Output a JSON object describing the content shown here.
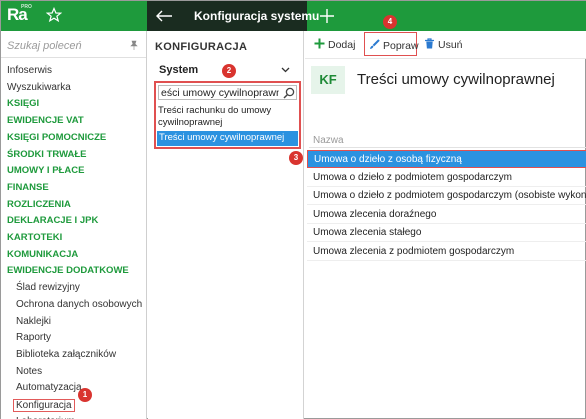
{
  "app": {
    "logo_text": "Ra",
    "logo_badge": "PRO",
    "window_title": "Konfiguracja systemu"
  },
  "leftnav": {
    "search_placeholder": "Szukaj poleceń",
    "items": [
      {
        "label": "Infoserwis",
        "kind": "plain"
      },
      {
        "label": "Wyszukiwarka",
        "kind": "plain"
      },
      {
        "label": "KSIĘGI",
        "kind": "sect"
      },
      {
        "label": "EWIDENCJE VAT",
        "kind": "sect"
      },
      {
        "label": "KSIĘGI POMOCNICZE",
        "kind": "sect"
      },
      {
        "label": "ŚRODKI TRWAŁE",
        "kind": "sect"
      },
      {
        "label": "UMOWY I PŁACE",
        "kind": "sect"
      },
      {
        "label": "FINANSE",
        "kind": "sect"
      },
      {
        "label": "ROZLICZENIA",
        "kind": "sect"
      },
      {
        "label": "DEKLARACJE I JPK",
        "kind": "sect"
      },
      {
        "label": "KARTOTEKI",
        "kind": "sect"
      },
      {
        "label": "KOMUNIKACJA",
        "kind": "sect"
      },
      {
        "label": "EWIDENCJE DODATKOWE",
        "kind": "sect"
      },
      {
        "label": "Ślad rewizyjny",
        "kind": "sub"
      },
      {
        "label": "Ochrona danych osobowych",
        "kind": "sub"
      },
      {
        "label": "Naklejki",
        "kind": "sub"
      },
      {
        "label": "Raporty",
        "kind": "sub"
      },
      {
        "label": "Biblioteka załączników",
        "kind": "sub"
      },
      {
        "label": "Notes",
        "kind": "sub"
      },
      {
        "label": "Automatyzacja",
        "kind": "sub"
      },
      {
        "label": "Konfiguracja",
        "kind": "sub"
      },
      {
        "label": "Laboratorium",
        "kind": "sub"
      }
    ]
  },
  "config": {
    "title": "KONFIGURACJA",
    "combo_value": "System",
    "search_value": "eści umowy cywilnoprawnej",
    "option1": "Treści rachunku do umowy cywilnoprawnej",
    "option2": "Treści umowy cywilnoprawnej"
  },
  "toolbar": {
    "add_label": "Dodaj",
    "edit_label": "Popraw",
    "delete_label": "Usuń"
  },
  "main": {
    "badge": "KF",
    "title": "Treści umowy cywilnoprawnej",
    "column_header": "Nazwa",
    "rows": [
      "Umowa o dzieło z osobą fizyczną",
      "Umowa o dzieło z podmiotem gospodarczym",
      "Umowa o dzieło z podmiotem gospodarczym (osobiste wykonanie)",
      "Umowa zlecenia doraźnego",
      "Umowa zlecenia stałego",
      "Umowa zlecenia z podmiotem gospodarczym"
    ]
  },
  "markers": [
    "1",
    "2",
    "3",
    "4"
  ],
  "colors": {
    "brand_green": "#1e9a3c",
    "selection_blue": "#2b92e0",
    "marker_red": "#d9342f"
  }
}
